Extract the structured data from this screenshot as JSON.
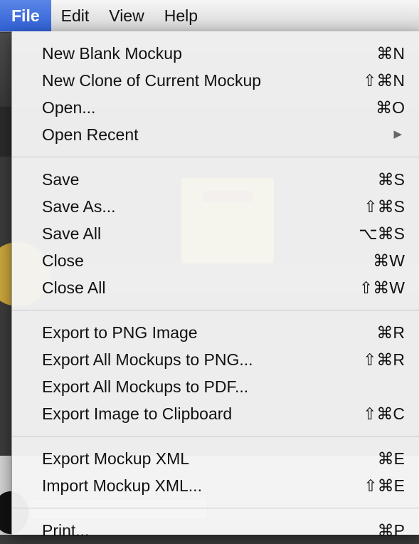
{
  "menubar": {
    "items": [
      "File",
      "Edit",
      "View",
      "Help"
    ],
    "active": "File"
  },
  "file_menu": {
    "groups": [
      [
        {
          "label": "New Blank Mockup",
          "shortcut": "⌘N"
        },
        {
          "label": "New Clone of Current Mockup",
          "shortcut": "⇧⌘N"
        },
        {
          "label": "Open...",
          "shortcut": "⌘O"
        },
        {
          "label": "Open Recent",
          "shortcut": "",
          "submenu": true
        }
      ],
      [
        {
          "label": "Save",
          "shortcut": "⌘S"
        },
        {
          "label": "Save As...",
          "shortcut": "⇧⌘S"
        },
        {
          "label": "Save All",
          "shortcut": "⌥⌘S"
        },
        {
          "label": "Close",
          "shortcut": "⌘W"
        },
        {
          "label": "Close All",
          "shortcut": "⇧⌘W"
        }
      ],
      [
        {
          "label": "Export to PNG Image",
          "shortcut": "⌘R"
        },
        {
          "label": "Export All Mockups to PNG...",
          "shortcut": "⇧⌘R"
        },
        {
          "label": "Export All Mockups to PDF...",
          "shortcut": ""
        },
        {
          "label": "Export Image to Clipboard",
          "shortcut": "⇧⌘C"
        }
      ],
      [
        {
          "label": "Export Mockup XML",
          "shortcut": "⌘E"
        },
        {
          "label": "Import Mockup XML...",
          "shortcut": "⇧⌘E"
        }
      ],
      [
        {
          "label": "Print...",
          "shortcut": "⌘P"
        }
      ]
    ],
    "submenu_arrow": "▶"
  }
}
